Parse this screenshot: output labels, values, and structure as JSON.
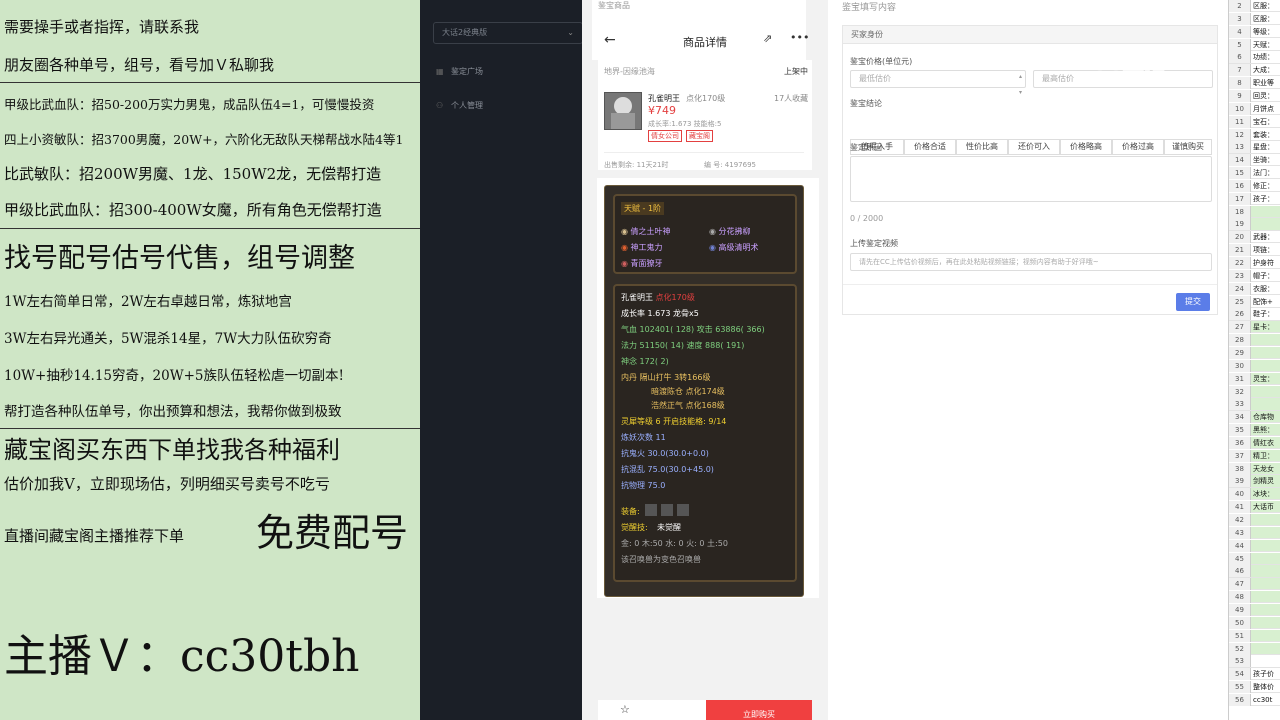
{
  "promo": {
    "lines": [
      "需要操手或者指挥，请联系我",
      "朋友圈各种单号，组号，看号加Ｖ私聊我",
      "甲级比武血队：招50-200万实力男鬼，成品队伍4=1，可慢慢投资",
      "四上小资敏队：招3700男魔，20W+，六阶化无敌队天梯帮战水陆4等1",
      "比武敏队：招200W男魔、1龙、150W2龙，无偿帮打造",
      "甲级比武血队：招300-400W女魔，所有角色无偿帮打造",
      "找号配号估号代售，组号调整",
      "1W左右简单日常，2W左右卓越日常，炼狱地宫",
      "3W左右异光通关，5W混杀14星，7W大力队伍砍穷奇",
      "10W+抽秒14.15穷奇，20W+5族队伍轻松虐一切副本!",
      "帮打造各种队伍单号，你出预算和想法，我帮你做到极致",
      "藏宝阁买东西下单找我各种福利",
      "估价加我V，立即现场估，列明细买号卖号不吃亏",
      "直播间藏宝阁主播推荐下单",
      "免费配号",
      "主播Ｖ：cc30tbh"
    ]
  },
  "nav": {
    "select": "大话2经典版",
    "items": [
      "鉴定广场",
      "个人管理"
    ]
  },
  "phone": {
    "section_label": "鉴宝商品",
    "title": "商品详情",
    "server_line": "地界-因缘池海",
    "status": "上架中",
    "role_name": "孔雀明王",
    "role_level": "点化170级",
    "favorites": "17人收藏",
    "price": "¥749",
    "growth_line": "成长率:1.673 技能格:5",
    "tags": [
      "倩女公司",
      "藏宝阁"
    ],
    "time_left": "出售剩余: 11天21时",
    "serial": "编  号: 4197695",
    "tianjue": "天赋 - 1阶",
    "skills": [
      "倩之土叶神",
      "分花拂柳",
      "神工鬼力",
      "高级清明术",
      "青面獠牙"
    ],
    "stats": [
      {
        "k": "孔雀明王",
        "v": "点化170级"
      },
      {
        "k": "成长率",
        "v": "1.673 龙骨x5"
      },
      {
        "k": "气血",
        "v": "102401( 128) 攻击 63886( 366)"
      },
      {
        "k": "法力",
        "v": "51150( 14) 速度 888( 191)"
      },
      {
        "k": "神念",
        "v": "172( 2)"
      },
      {
        "k": "内丹",
        "v": "隔山打牛 3转166级"
      },
      {
        "k": "",
        "v": "暗渡陈仓 点化174级"
      },
      {
        "k": "",
        "v": "浩然正气 点化168级"
      },
      {
        "k": "灵犀等级",
        "v": "6 开启技能格: 9/14"
      },
      {
        "k": "炼妖次数",
        "v": "11"
      },
      {
        "k": "抗鬼火",
        "v": "30.0(30.0+0.0)"
      },
      {
        "k": "抗混乱",
        "v": "75.0(30.0+45.0)"
      },
      {
        "k": "抗物理",
        "v": "75.0"
      }
    ],
    "equip_label": "装备:",
    "awaken_label": "觉醒技:",
    "awaken_value": "未觉醒",
    "elements": "金: 0 木:50 水: 0 火: 0 土:50",
    "summon_note": "该召唤兽为变色召唤兽",
    "buy_button": "立即购买"
  },
  "form": {
    "section_label": "鉴宝填写内容",
    "panel_title": "买家身份",
    "price_label": "鉴宝价格(单位元)",
    "min_placeholder": "最低估价",
    "max_placeholder": "最高估价",
    "conclusion_label": "鉴宝结论",
    "options": [
      "值得入手",
      "价格合适",
      "性价比高",
      "还价可入",
      "价格略高",
      "价格过高",
      "谨慎购买"
    ],
    "reason_label": "鉴定原因",
    "counter": "0 / 2000",
    "video_label": "上传鉴定视频",
    "video_placeholder": "请先在CC上传估价视频后，再在此处粘贴视频链接；视频内容有助于好评哦~",
    "submit": "提交"
  },
  "sheet": {
    "rows": [
      {
        "n": "2",
        "t": "区服："
      },
      {
        "n": "3",
        "t": "区服："
      },
      {
        "n": "4",
        "t": "等级："
      },
      {
        "n": "5",
        "t": "天赋："
      },
      {
        "n": "6",
        "t": "功绩："
      },
      {
        "n": "7",
        "t": "大成："
      },
      {
        "n": "8",
        "t": "职业等"
      },
      {
        "n": "9",
        "t": "回灵："
      },
      {
        "n": "10",
        "t": "月饼点"
      },
      {
        "n": "11",
        "t": "宝石："
      },
      {
        "n": "12",
        "t": "套装："
      },
      {
        "n": "13",
        "t": "星盘："
      },
      {
        "n": "14",
        "t": "坐骑："
      },
      {
        "n": "15",
        "t": "法门："
      },
      {
        "n": "16",
        "t": "修正："
      },
      {
        "n": "17",
        "t": "孩子："
      },
      {
        "n": "18",
        "t": ""
      },
      {
        "n": "19",
        "t": ""
      },
      {
        "n": "20",
        "t": "武器："
      },
      {
        "n": "21",
        "t": "项链："
      },
      {
        "n": "22",
        "t": "护身符"
      },
      {
        "n": "23",
        "t": "帽子："
      },
      {
        "n": "24",
        "t": "衣服："
      },
      {
        "n": "25",
        "t": "配饰+"
      },
      {
        "n": "26",
        "t": "鞋子："
      },
      {
        "n": "27",
        "t": "星卡："
      },
      {
        "n": "28",
        "t": ""
      },
      {
        "n": "29",
        "t": ""
      },
      {
        "n": "30",
        "t": ""
      },
      {
        "n": "31",
        "t": "灵宝："
      },
      {
        "n": "32",
        "t": ""
      },
      {
        "n": "33",
        "t": ""
      },
      {
        "n": "34",
        "t": "仓库物"
      },
      {
        "n": "35",
        "t": "黑熊："
      },
      {
        "n": "36",
        "t": "倩红衣"
      },
      {
        "n": "37",
        "t": "精卫："
      },
      {
        "n": "38",
        "t": "天龙女"
      },
      {
        "n": "39",
        "t": "剑精灵"
      },
      {
        "n": "40",
        "t": "冰块："
      },
      {
        "n": "41",
        "t": "大话币"
      },
      {
        "n": "42",
        "t": ""
      },
      {
        "n": "43",
        "t": ""
      },
      {
        "n": "44",
        "t": ""
      },
      {
        "n": "45",
        "t": ""
      },
      {
        "n": "46",
        "t": ""
      },
      {
        "n": "47",
        "t": ""
      },
      {
        "n": "48",
        "t": ""
      },
      {
        "n": "49",
        "t": ""
      },
      {
        "n": "50",
        "t": ""
      },
      {
        "n": "51",
        "t": ""
      },
      {
        "n": "52",
        "t": ""
      },
      {
        "n": "53",
        "t": ""
      },
      {
        "n": "54",
        "t": "孩子价"
      },
      {
        "n": "55",
        "t": "整体价"
      },
      {
        "n": "56",
        "t": "cc30t"
      }
    ]
  },
  "watermark": "CC直播"
}
